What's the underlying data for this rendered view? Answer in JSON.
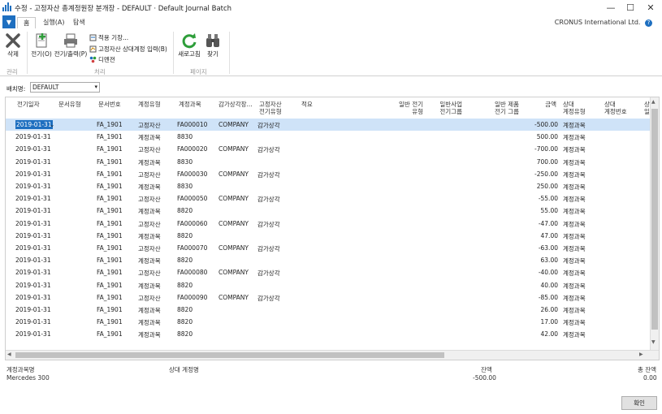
{
  "window": {
    "title": "수정 - 고정자산 총계정원장 분개장 - DEFAULT · Default Journal Batch",
    "minimize": "—",
    "maximize": "☐",
    "close": "✕"
  },
  "ribbon": {
    "file_tab": "▼",
    "tabs": [
      "홈",
      "실행(A)",
      "탐색"
    ],
    "company": "CRONUS International Ltd.",
    "help": "?",
    "groups": {
      "manage": {
        "label": "관리",
        "delete": "삭제"
      },
      "process": {
        "label": "처리",
        "post": "전기(O)",
        "post_print": "전기/출력(P)",
        "apply_entries": "적용 기장...",
        "fa_offset": "고정자산 상대계정 입력(B)",
        "dimensions": "디멘젼"
      },
      "page": {
        "label": "페이지",
        "refresh": "새로고침",
        "find": "찾기"
      }
    }
  },
  "batch": {
    "label": "배치명:",
    "value": "DEFAULT"
  },
  "grid": {
    "headers": [
      [
        "전기일자"
      ],
      [
        "문서유형"
      ],
      [
        "문서번호"
      ],
      [
        "계정유형"
      ],
      [
        "계정과목"
      ],
      [
        "감가상각장..."
      ],
      [
        "고정자산",
        "전기유형"
      ],
      [
        "적요"
      ],
      [
        "일반 전기",
        "유형"
      ],
      [
        "일반사업",
        "전기그룹"
      ],
      [
        "일반 제품",
        "전기 그룹"
      ],
      [
        "금액"
      ],
      [
        "상대",
        "계정유형"
      ],
      [
        "상대",
        "계정번호"
      ],
      [
        "상",
        "일"
      ]
    ],
    "rows": [
      [
        "2019-01-31",
        "FA_1901",
        "고정자산",
        "FA000010",
        "COMPANY",
        "감가상각",
        "-500.00",
        "계정과목"
      ],
      [
        "2019-01-31",
        "FA_1901",
        "계정과목",
        "8830",
        "",
        "",
        "500.00",
        "계정과목"
      ],
      [
        "2019-01-31",
        "FA_1901",
        "고정자산",
        "FA000020",
        "COMPANY",
        "감가상각",
        "-700.00",
        "계정과목"
      ],
      [
        "2019-01-31",
        "FA_1901",
        "계정과목",
        "8830",
        "",
        "",
        "700.00",
        "계정과목"
      ],
      [
        "2019-01-31",
        "FA_1901",
        "고정자산",
        "FA000030",
        "COMPANY",
        "감가상각",
        "-250.00",
        "계정과목"
      ],
      [
        "2019-01-31",
        "FA_1901",
        "계정과목",
        "8830",
        "",
        "",
        "250.00",
        "계정과목"
      ],
      [
        "2019-01-31",
        "FA_1901",
        "고정자산",
        "FA000050",
        "COMPANY",
        "감가상각",
        "-55.00",
        "계정과목"
      ],
      [
        "2019-01-31",
        "FA_1901",
        "계정과목",
        "8820",
        "",
        "",
        "55.00",
        "계정과목"
      ],
      [
        "2019-01-31",
        "FA_1901",
        "고정자산",
        "FA000060",
        "COMPANY",
        "감가상각",
        "-47.00",
        "계정과목"
      ],
      [
        "2019-01-31",
        "FA_1901",
        "계정과목",
        "8820",
        "",
        "",
        "47.00",
        "계정과목"
      ],
      [
        "2019-01-31",
        "FA_1901",
        "고정자산",
        "FA000070",
        "COMPANY",
        "감가상각",
        "-63.00",
        "계정과목"
      ],
      [
        "2019-01-31",
        "FA_1901",
        "계정과목",
        "8820",
        "",
        "",
        "63.00",
        "계정과목"
      ],
      [
        "2019-01-31",
        "FA_1901",
        "고정자산",
        "FA000080",
        "COMPANY",
        "감가상각",
        "-40.00",
        "계정과목"
      ],
      [
        "2019-01-31",
        "FA_1901",
        "계정과목",
        "8820",
        "",
        "",
        "40.00",
        "계정과목"
      ],
      [
        "2019-01-31",
        "FA_1901",
        "고정자산",
        "FA000090",
        "COMPANY",
        "감가상각",
        "-85.00",
        "계정과목"
      ],
      [
        "2019-01-31",
        "FA_1901",
        "계정과목",
        "8820",
        "",
        "",
        "26.00",
        "계정과목"
      ],
      [
        "2019-01-31",
        "FA_1901",
        "계정과목",
        "8820",
        "",
        "",
        "17.00",
        "계정과목"
      ],
      [
        "2019-01-31",
        "FA_1901",
        "계정과목",
        "8820",
        "",
        "",
        "42.00",
        "계정과목"
      ]
    ]
  },
  "footer": {
    "account_name_label": "계정과목명",
    "account_name_value": "Mercedes 300",
    "bal_account_label": "상대 계정명",
    "balance_label": "잔액",
    "balance_value": "-500.00",
    "total_balance_label": "총 잔액",
    "total_balance_value": "0.00",
    "ok": "확인"
  }
}
